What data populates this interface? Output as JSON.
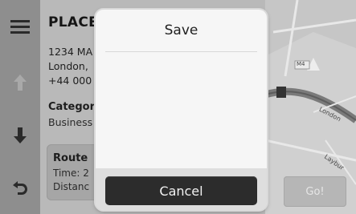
{
  "place": {
    "title": "PLACE",
    "address_line1": "1234 MA",
    "address_line2": "London,",
    "phone": "+44 000"
  },
  "category": {
    "label": "Categor",
    "value": "Business"
  },
  "route": {
    "title": "Route",
    "time": "Time: 2",
    "distance": "Distanc"
  },
  "map": {
    "road_shield": "M4",
    "street1": "London",
    "street2": "Laybur"
  },
  "nav": {
    "menu_icon": "hamburger-menu-icon",
    "up_icon": "arrow-up-icon",
    "down_icon": "arrow-down-icon",
    "back_icon": "back-arrow-icon"
  },
  "go_button": {
    "label": "Go!"
  },
  "dialog": {
    "title": "Save",
    "cancel_label": "Cancel"
  }
}
